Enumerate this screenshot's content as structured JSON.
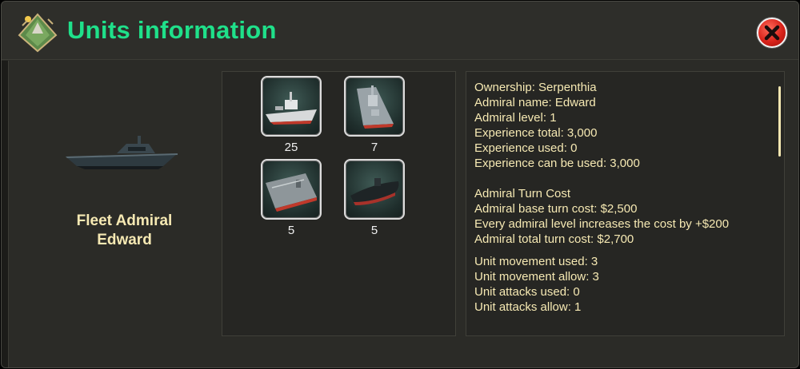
{
  "window": {
    "title": "Units information",
    "logo_icon": "island-emblem-icon",
    "close_icon": "close-x-icon",
    "title_color": "#1fe08a"
  },
  "admiral": {
    "ship_icon": "speedboat-icon",
    "name_line1": "Fleet Admiral",
    "name_line2": "Edward"
  },
  "units": [
    {
      "icon": "cruiser-ship-icon",
      "count": "25"
    },
    {
      "icon": "destroyer-ship-icon",
      "count": "7"
    },
    {
      "icon": "aircraft-carrier-icon",
      "count": "5"
    },
    {
      "icon": "submarine-icon",
      "count": "5"
    }
  ],
  "info": {
    "block1": [
      "Ownership: Serpenthia",
      "Admiral name: Edward",
      "Admiral level: 1",
      "Experience total: 3,000",
      "Experience used: 0",
      "Experience can be used: 3,000"
    ],
    "block2": [
      "Admiral Turn Cost",
      "Admiral base turn cost: $2,500",
      "Every admiral level increases the cost by +$200",
      "Admiral total turn cost: $2,700"
    ],
    "block3": [
      "Unit movement used: 3",
      "Unit movement allow: 3",
      "Unit attacks used: 0",
      "Unit attacks allow: 1"
    ]
  }
}
